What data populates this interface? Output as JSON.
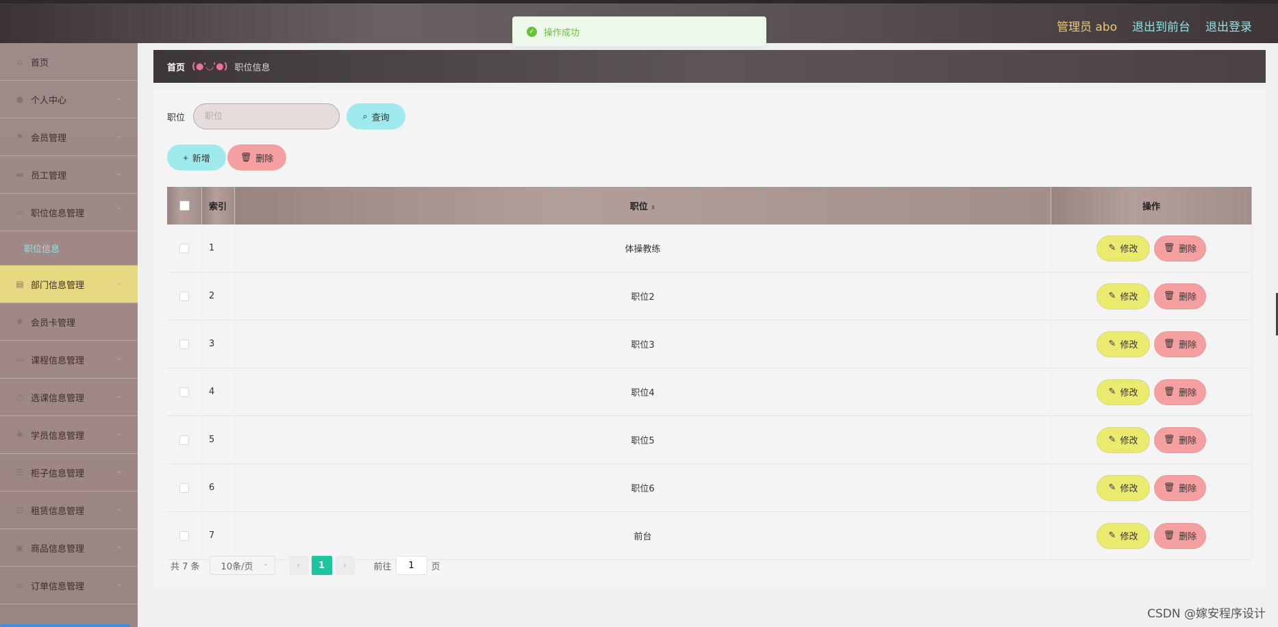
{
  "topbar": {
    "admin_label": "管理员 abo",
    "front_link": "退出到前台",
    "logout_link": "退出登录"
  },
  "toast": {
    "message": "操作成功",
    "icon": "check-circle-icon",
    "color": "#67c23a"
  },
  "sidebar": {
    "items": [
      {
        "label": "首页",
        "icon": "home-icon"
      },
      {
        "label": "个人中心",
        "icon": "user-icon"
      },
      {
        "label": "会员管理",
        "icon": "flag-icon"
      },
      {
        "label": "员工管理",
        "icon": "chat-icon"
      },
      {
        "label": "职位信息管理",
        "icon": "tv-icon"
      }
    ],
    "submenu": {
      "label": "职位信息"
    },
    "items_after": [
      {
        "label": "部门信息管理",
        "icon": "clipboard-icon",
        "active": true
      },
      {
        "label": "会员卡管理",
        "icon": "gear-icon"
      },
      {
        "label": "课程信息管理",
        "icon": "tv-icon"
      },
      {
        "label": "选课信息管理",
        "icon": "clock-icon"
      },
      {
        "label": "学员信息管理",
        "icon": "gear-icon"
      },
      {
        "label": "柜子信息管理",
        "icon": "list-icon"
      },
      {
        "label": "租赁信息管理",
        "icon": "lock-icon"
      },
      {
        "label": "商品信息管理",
        "icon": "box-icon"
      },
      {
        "label": "订单信息管理",
        "icon": "tv-icon"
      }
    ]
  },
  "breadcrumb": {
    "home": "首页",
    "separator": "(●'◡'●)",
    "current": "职位信息"
  },
  "search": {
    "label": "职位",
    "placeholder": "职位",
    "button": "查询"
  },
  "actions": {
    "add": "新增",
    "delete": "删除"
  },
  "table": {
    "columns": [
      "索引",
      "职位",
      "操作"
    ],
    "rows": [
      {
        "index": "1",
        "position": "体操教练"
      },
      {
        "index": "2",
        "position": "职位2"
      },
      {
        "index": "3",
        "position": "职位3"
      },
      {
        "index": "4",
        "position": "职位4"
      },
      {
        "index": "5",
        "position": "职位5"
      },
      {
        "index": "6",
        "position": "职位6"
      },
      {
        "index": "7",
        "position": "前台"
      }
    ],
    "row_edit": "修改",
    "row_delete": "删除"
  },
  "pagination": {
    "total": "共 7 条",
    "page_size": "10条/页",
    "current_page": "1",
    "goto_label": "前往",
    "goto_value": "1",
    "page_suffix": "页"
  },
  "watermark": "CSDN @嫁安程序设计",
  "colors": {
    "accent_teal": "#9eeaec",
    "delete_pink": "#f5a0a0",
    "edit_yellow": "#eaeb6e",
    "active_menu": "#e5d880",
    "page_active": "#1ec6a0"
  }
}
